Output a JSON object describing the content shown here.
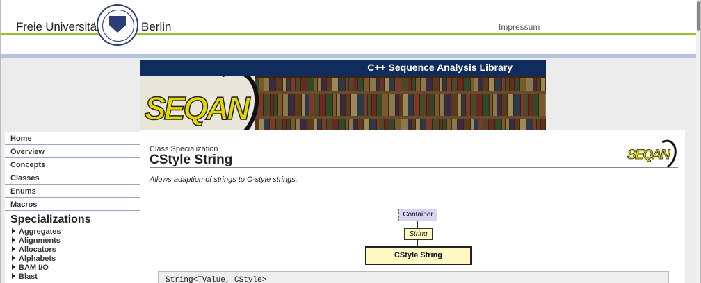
{
  "header": {
    "university_name": "Freie Universität",
    "university_city": "Berlin",
    "impressum_label": "Impressum"
  },
  "banner": {
    "title": "C++ Sequence Analysis Library",
    "logo_text": "SEQAN"
  },
  "sidebar": {
    "nav": [
      {
        "label": "Home"
      },
      {
        "label": "Overview"
      },
      {
        "label": "Concepts"
      },
      {
        "label": "Classes"
      },
      {
        "label": "Enums"
      },
      {
        "label": "Macros"
      }
    ],
    "section_title": "Specializations",
    "specializations": [
      {
        "label": "Aggregates"
      },
      {
        "label": "Alignments"
      },
      {
        "label": "Allocators"
      },
      {
        "label": "Alphabets"
      },
      {
        "label": "BAM I/O"
      },
      {
        "label": "Blast"
      }
    ]
  },
  "content": {
    "kicker": "Class Specialization",
    "title": "CStyle String",
    "description": "Allows adaption of strings to C-style strings.",
    "small_logo_text": "SEQAN",
    "diagram": {
      "container_label": "Container",
      "string_label": "String",
      "cstyle_label": "CStyle String"
    },
    "code_signature": "String<TValue, CStyle>"
  },
  "colors": {
    "green_accent": "#9ac02f",
    "navy_bar": "#0f2c5c",
    "blue_line": "#b5c4dc",
    "logo_yellow": "#e6d700"
  }
}
